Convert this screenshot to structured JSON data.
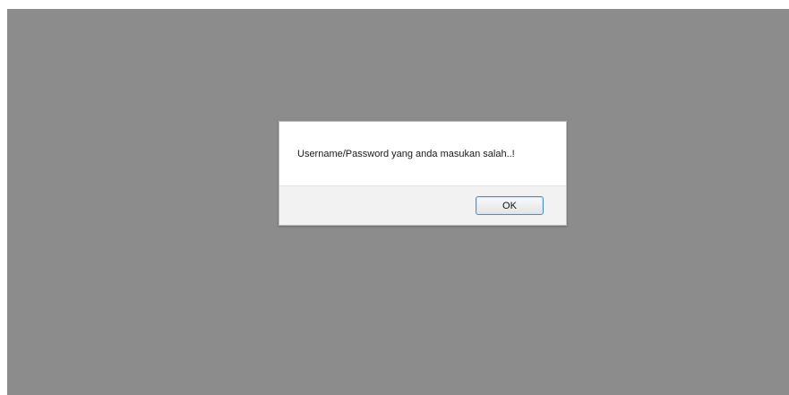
{
  "dialog": {
    "message": "Username/Password yang anda masukan salah..!",
    "ok_label": "OK"
  },
  "colors": {
    "overlay": "#8c8c8d",
    "dialog_background": "#ffffff",
    "footer_background": "#f2f2f2",
    "button_border": "#4a8fd6"
  }
}
